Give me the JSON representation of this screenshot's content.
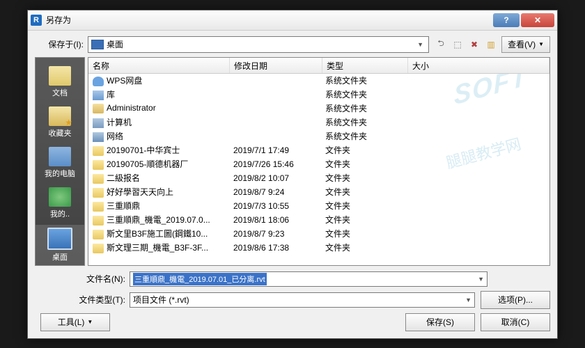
{
  "window": {
    "title": "另存为",
    "app_letter": "R",
    "help_label": "?",
    "close_label": "✕"
  },
  "top": {
    "save_in_label": "保存于(I):",
    "location": "桌面",
    "view_label": "查看(V)"
  },
  "sidebar": [
    {
      "label": "文档",
      "icon": "i-doc"
    },
    {
      "label": "收藏夹",
      "icon": "i-fav"
    },
    {
      "label": "我的电脑",
      "icon": "i-pc"
    },
    {
      "label": "我的..",
      "icon": "i-net"
    },
    {
      "label": "桌面",
      "icon": "i-desk",
      "sel": true
    },
    {
      "label": "",
      "icon": "i-fold"
    }
  ],
  "columns": {
    "name": "名称",
    "date": "修改日期",
    "type": "类型",
    "size": "大小"
  },
  "rows": [
    {
      "icon": "f-cloud",
      "name": "WPS网盘",
      "date": "",
      "type": "系统文件夹"
    },
    {
      "icon": "f-lib",
      "name": "库",
      "date": "",
      "type": "系统文件夹"
    },
    {
      "icon": "f-user",
      "name": "Administrator",
      "date": "",
      "type": "系统文件夹"
    },
    {
      "icon": "f-comp",
      "name": "计算机",
      "date": "",
      "type": "系统文件夹"
    },
    {
      "icon": "f-netw",
      "name": "网络",
      "date": "",
      "type": "系统文件夹"
    },
    {
      "icon": "f-folder",
      "name": "20190701-中华宾士",
      "date": "2019/7/1 17:49",
      "type": "文件夹"
    },
    {
      "icon": "f-folder",
      "name": "20190705-順德机器厂",
      "date": "2019/7/26 15:46",
      "type": "文件夹"
    },
    {
      "icon": "f-folder",
      "name": "二級报名",
      "date": "2019/8/2 10:07",
      "type": "文件夹"
    },
    {
      "icon": "f-folder",
      "name": "好好學習天天向上",
      "date": "2019/8/7 9:24",
      "type": "文件夹"
    },
    {
      "icon": "f-folder",
      "name": "三重順鼎",
      "date": "2019/7/3 10:55",
      "type": "文件夹"
    },
    {
      "icon": "f-folder",
      "name": "三重順鼎_機電_2019.07.0...",
      "date": "2019/8/1 18:06",
      "type": "文件夹"
    },
    {
      "icon": "f-folder",
      "name": "斯文里B3F施工圖(鋼鐵10...",
      "date": "2019/8/7 9:23",
      "type": "文件夹"
    },
    {
      "icon": "f-folder",
      "name": "斯文理三期_機電_B3F-3F...",
      "date": "2019/8/6 17:38",
      "type": "文件夹"
    }
  ],
  "filename": {
    "label": "文件名(N):",
    "value": "三重順鼎_機電_2019.07.01_已分离.rvt"
  },
  "filetype": {
    "label": "文件类型(T):",
    "value": "项目文件 (*.rvt)"
  },
  "buttons": {
    "options": "选项(P)...",
    "tools": "工具(L)",
    "save": "保存(S)",
    "cancel": "取消(C)"
  },
  "watermark": {
    "line1": "SOFT",
    "line2": "腿腿教学网"
  }
}
